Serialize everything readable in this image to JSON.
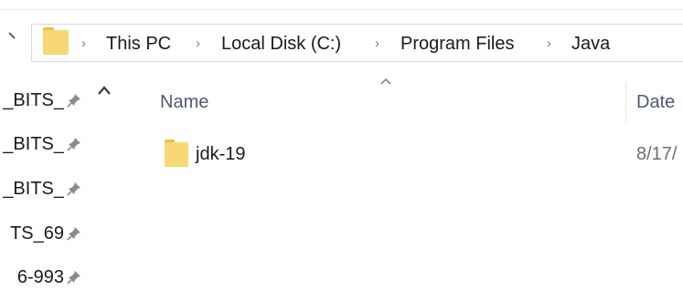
{
  "breadcrumb": {
    "items": [
      "This PC",
      "Local Disk (C:)",
      "Program Files",
      "Java"
    ],
    "separator": "›"
  },
  "nav_pane": {
    "items": [
      {
        "label": "_BITS_"
      },
      {
        "label": "_BITS_"
      },
      {
        "label": "_BITS_"
      },
      {
        "label": "TS_69"
      },
      {
        "label": "6-993"
      }
    ]
  },
  "file_list": {
    "columns": {
      "name": "Name",
      "date": "Date"
    },
    "rows": [
      {
        "name": "jdk-19",
        "date": "8/17/"
      }
    ]
  },
  "icons": {
    "folder": "folder-icon",
    "pin": "pin-icon",
    "sort": "sort-ascending-icon",
    "collapse": "chevron-up-icon",
    "breadcrumb_up": "up-arrow-icon"
  },
  "colors": {
    "folder_body": "#f8d775",
    "folder_tab": "#e8c04a",
    "header_text": "#4c5b73"
  }
}
